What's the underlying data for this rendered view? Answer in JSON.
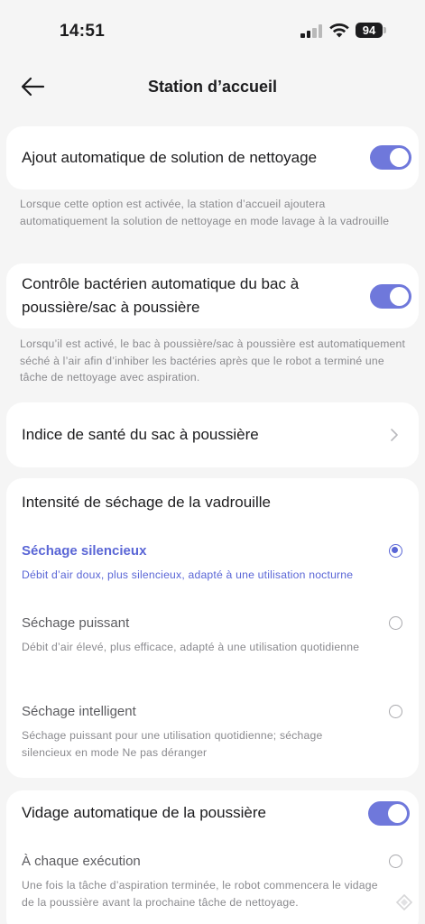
{
  "status_bar": {
    "time": "14:51",
    "battery": "94"
  },
  "header": {
    "title": "Station d’accueil"
  },
  "auto_solution": {
    "label": "Ajout automatique de solution de nettoyage",
    "enabled": true,
    "description": "Lorsque cette option est activée, la station d’accueil ajoutera automatiquement la solution de nettoyage en mode lavage à la vadrouille"
  },
  "bacteria_control": {
    "label": "Contrôle bactérien automatique du bac à poussière/sac à poussière",
    "enabled": true,
    "description": "Lorsqu’il est activé, le bac à poussière/sac à poussière est automatiquement séché à l’air afin d’inhiber les bactéries après que le robot a terminé une tâche de nettoyage avec aspiration."
  },
  "dust_bag_health": {
    "label": "Indice de santé du sac à poussière"
  },
  "mop_drying": {
    "title": "Intensité de séchage de la vadrouille",
    "options": [
      {
        "label": "Séchage silencieux",
        "description": "Débit d’air doux, plus silencieux, adapté à une utilisation nocturne",
        "selected": true
      },
      {
        "label": "Séchage puissant",
        "description": "Débit d’air élevé, plus efficace, adapté à une utilisation quotidienne",
        "selected": false
      },
      {
        "label": "Séchage intelligent",
        "description": "Séchage puissant pour une utilisation quotidienne; séchage silencieux en mode Ne pas déranger",
        "selected": false
      }
    ]
  },
  "auto_empty": {
    "label": "Vidage automatique de la poussière",
    "enabled": true,
    "options": [
      {
        "label": "À chaque exécution",
        "description": "Une fois la tâche d’aspiration terminée, le robot commencera le vidage de la poussière avant la prochaine tâche de nettoyage.",
        "selected": false
      }
    ]
  },
  "colors": {
    "accent": "#5a66d6",
    "toggle_on": "#6f78db",
    "background": "#f5f5f5"
  },
  "icons": {
    "back": "arrow-left-icon",
    "chevron": "chevron-right-icon"
  }
}
